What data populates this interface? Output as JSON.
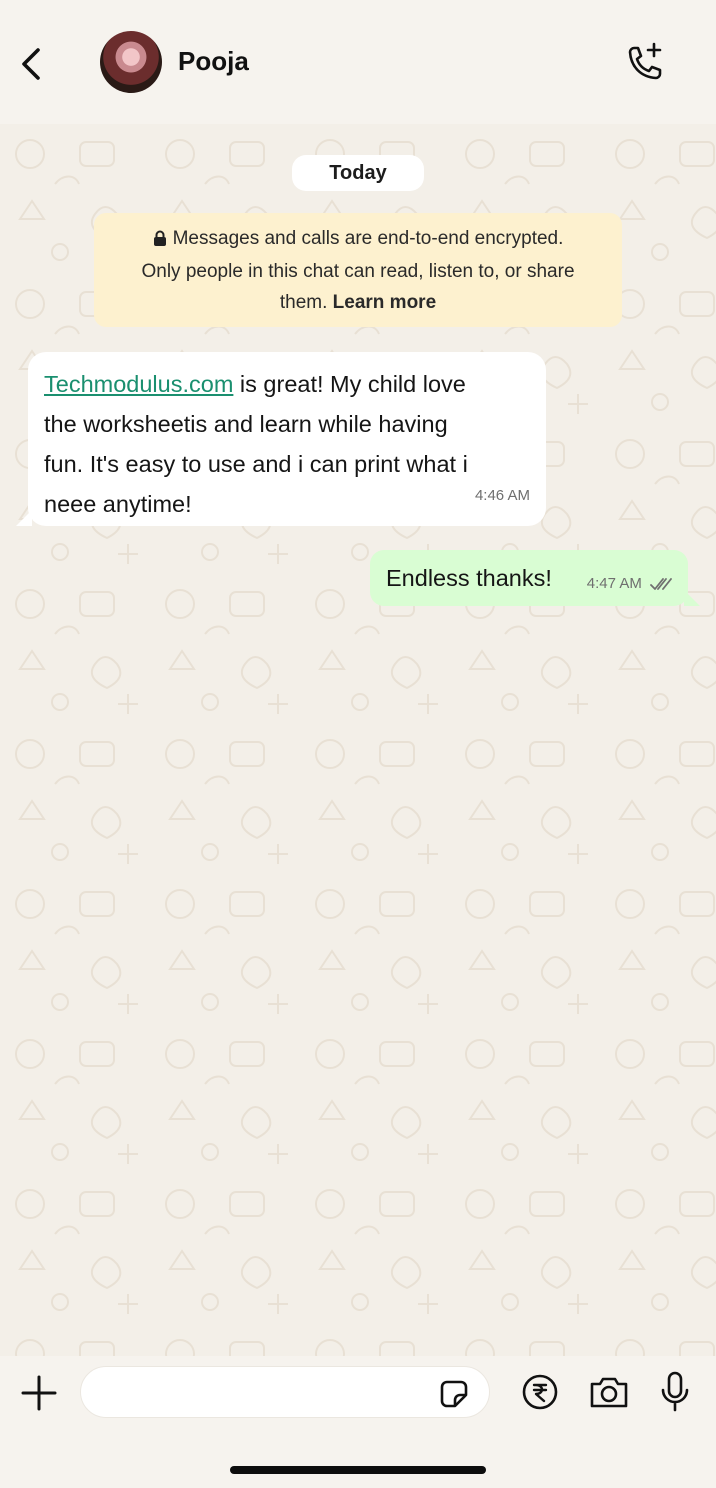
{
  "header": {
    "contact_name": "Pooja",
    "back_icon": "chevron-left-icon",
    "call_icon": "phone-add-icon"
  },
  "chat": {
    "date_label": "Today",
    "encryption": {
      "line1": "Messages and calls are end-to-end encrypted.",
      "line2": "Only people in this chat can read, listen to, or share",
      "line3_prefix": "them. ",
      "learn_more": "Learn more"
    },
    "messages": [
      {
        "direction": "incoming",
        "link_text": "Techmodulus.com",
        "text_line1": " is great! My child love",
        "text_line2": "the worksheetis and learn while having",
        "text_line3": "fun. It's easy to use and i can print what i",
        "text_line4": "neee anytime!",
        "time": "4:46 AM"
      },
      {
        "direction": "outgoing",
        "text": "Endless thanks!",
        "time": "4:47 AM",
        "status": "read-ticks"
      }
    ]
  },
  "input_bar": {
    "placeholder": "",
    "icons": [
      "plus-icon",
      "sticker-icon",
      "rupee-icon",
      "camera-icon",
      "microphone-icon"
    ]
  },
  "colors": {
    "background": "#f3efe8",
    "incoming_bubble": "#ffffff",
    "outgoing_bubble": "#d9fdd3",
    "encryption_notice": "#fdf1cf",
    "link": "#1a8f6f"
  }
}
